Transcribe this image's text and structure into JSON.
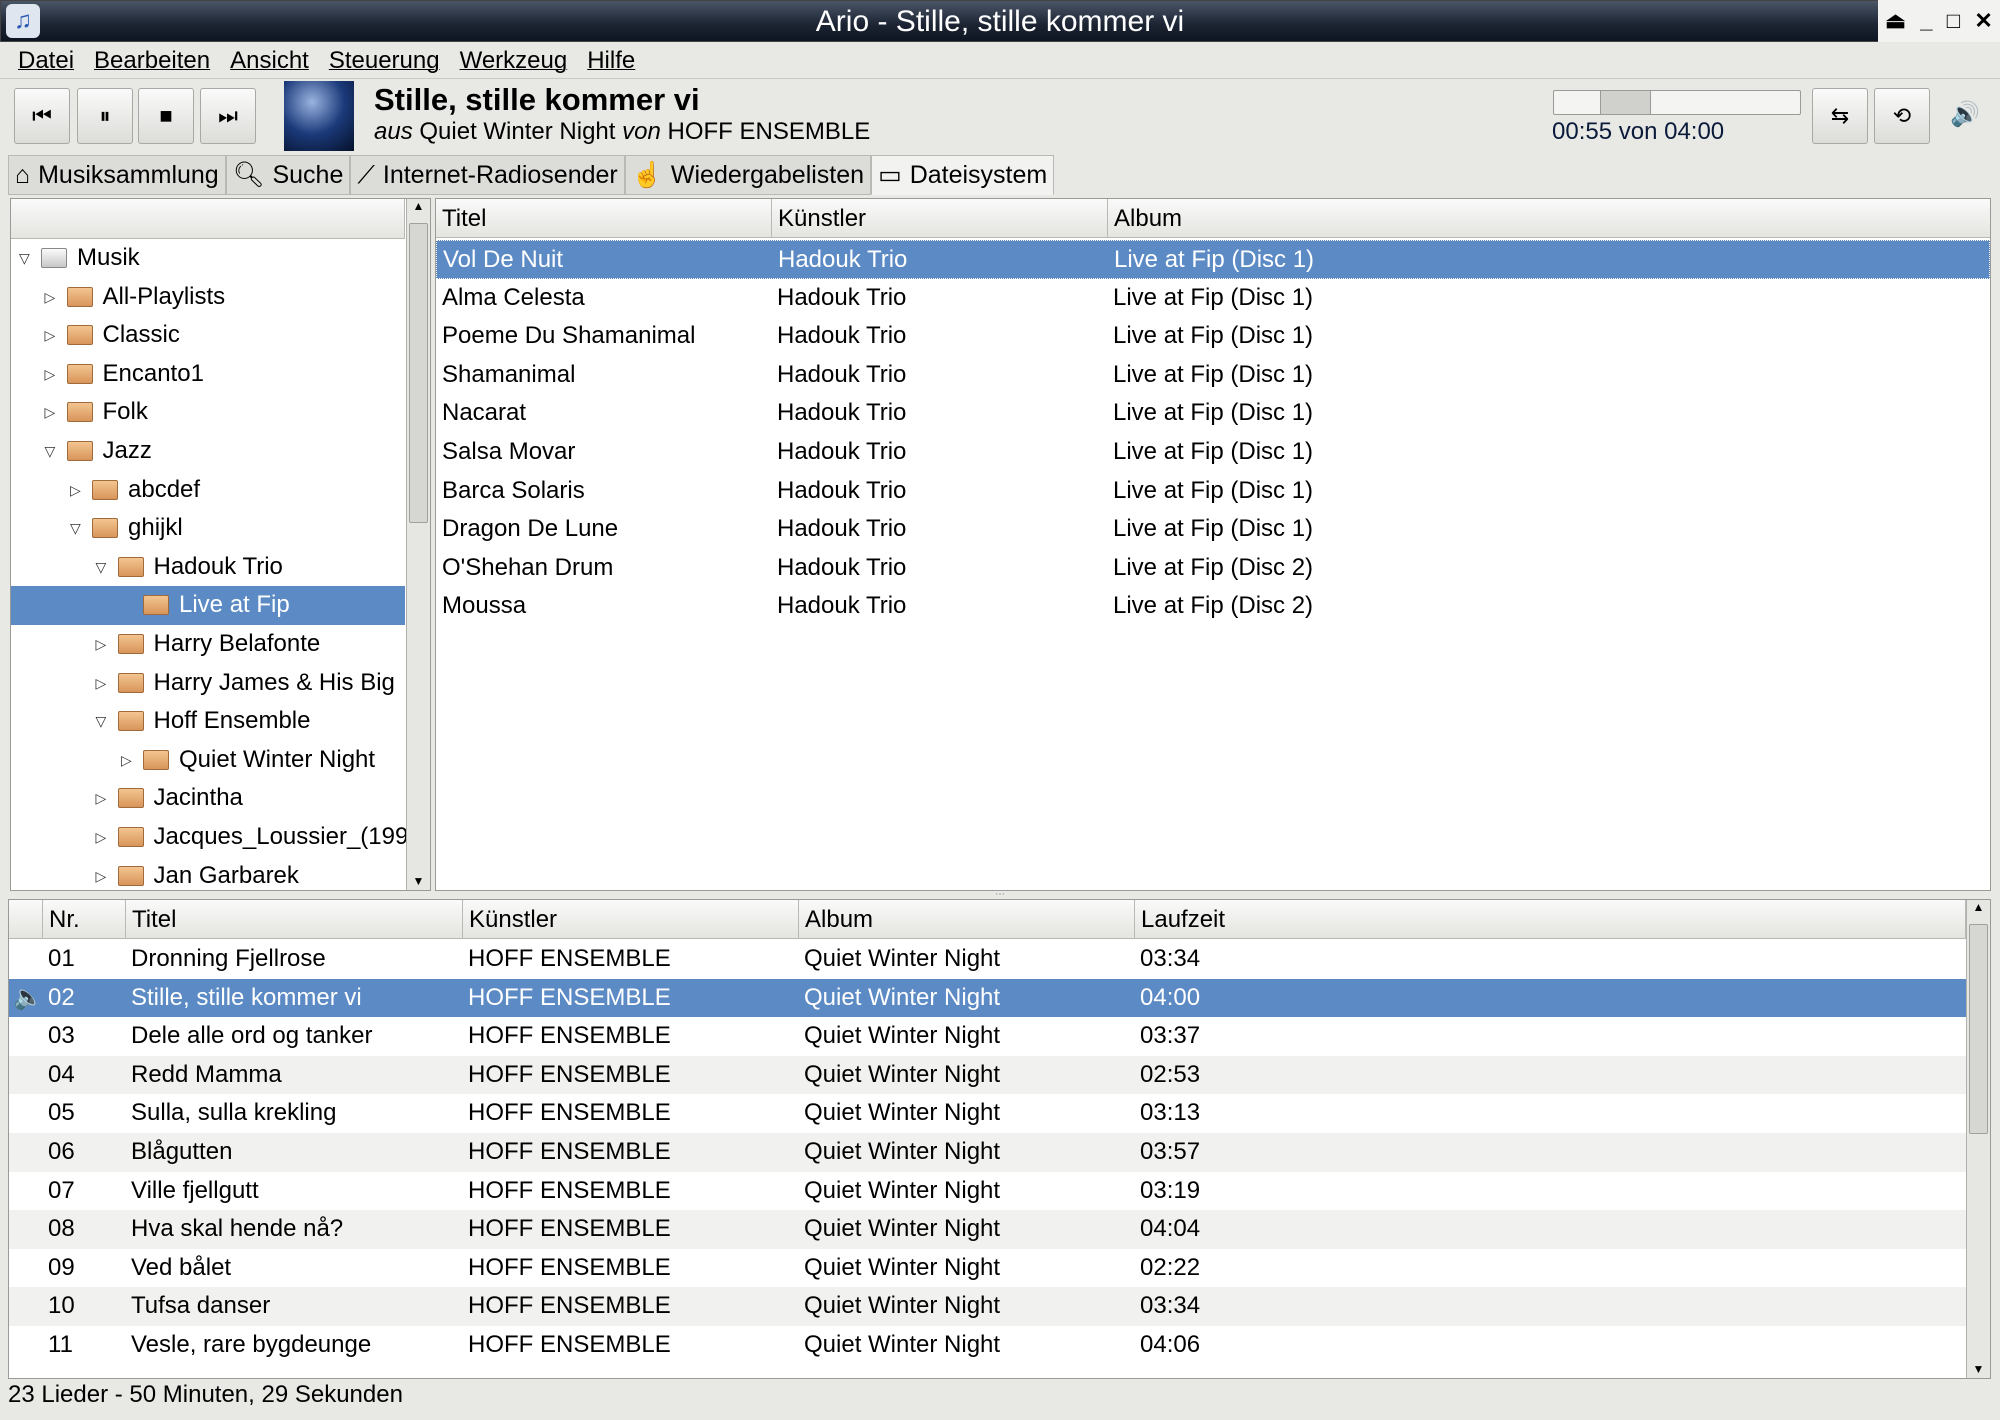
{
  "window": {
    "title": "Ario - Stille, stille kommer vi",
    "buttons": [
      "shade",
      "minimize",
      "maximize",
      "close"
    ]
  },
  "menu": [
    "Datei",
    "Bearbeiten",
    "Ansicht",
    "Steuerung",
    "Werkzeug",
    "Hilfe"
  ],
  "player": {
    "now_title": "Stille, stille kommer vi",
    "aus": "aus",
    "album": "Quiet Winter Night",
    "von": "von",
    "artist": "HOFF ENSEMBLE",
    "time": "00:55 von 04:00",
    "progress_fraction": 0.229
  },
  "tabs": [
    {
      "label": "Musiksammlung",
      "icon": "home-icon"
    },
    {
      "label": "Suche",
      "icon": "search-icon"
    },
    {
      "label": "Internet-Radiosender",
      "icon": "radio-icon"
    },
    {
      "label": "Wiedergabelisten",
      "icon": "playlist-icon"
    },
    {
      "label": "Dateisystem",
      "icon": "drive-icon",
      "active": true
    }
  ],
  "tree": [
    {
      "label": "Musik",
      "depth": 0,
      "exp": "open",
      "root": true
    },
    {
      "label": "All-Playlists",
      "depth": 1,
      "exp": "closed"
    },
    {
      "label": "Classic",
      "depth": 1,
      "exp": "closed"
    },
    {
      "label": "Encanto1",
      "depth": 1,
      "exp": "closed"
    },
    {
      "label": "Folk",
      "depth": 1,
      "exp": "closed"
    },
    {
      "label": "Jazz",
      "depth": 1,
      "exp": "open"
    },
    {
      "label": "abcdef",
      "depth": 2,
      "exp": "closed"
    },
    {
      "label": "ghijkl",
      "depth": 2,
      "exp": "open"
    },
    {
      "label": "Hadouk Trio",
      "depth": 3,
      "exp": "open"
    },
    {
      "label": "Live at Fip",
      "depth": 4,
      "exp": "none",
      "selected": true
    },
    {
      "label": "Harry Belafonte",
      "depth": 3,
      "exp": "closed"
    },
    {
      "label": "Harry James & His Big",
      "depth": 3,
      "exp": "closed"
    },
    {
      "label": "Hoff Ensemble",
      "depth": 3,
      "exp": "open"
    },
    {
      "label": "Quiet Winter Night",
      "depth": 4,
      "exp": "closed"
    },
    {
      "label": "Jacintha",
      "depth": 3,
      "exp": "closed"
    },
    {
      "label": "Jacques_Loussier_(199",
      "depth": 3,
      "exp": "closed"
    },
    {
      "label": "Jan Garbarek",
      "depth": 3,
      "exp": "closed"
    }
  ],
  "songs": {
    "columns": [
      "Titel",
      "Künstler",
      "Album"
    ],
    "rows": [
      [
        "Vol De Nuit",
        "Hadouk Trio",
        "Live at Fip (Disc 1)"
      ],
      [
        "Alma Celesta",
        "Hadouk Trio",
        "Live at Fip (Disc 1)"
      ],
      [
        "Poeme Du Shamanimal",
        "Hadouk Trio",
        "Live at Fip (Disc 1)"
      ],
      [
        "Shamanimal",
        "Hadouk Trio",
        "Live at Fip (Disc 1)"
      ],
      [
        "Nacarat",
        "Hadouk Trio",
        "Live at Fip (Disc 1)"
      ],
      [
        "Salsa Movar",
        "Hadouk Trio",
        "Live at Fip (Disc 1)"
      ],
      [
        "Barca Solaris",
        "Hadouk Trio",
        "Live at Fip (Disc 1)"
      ],
      [
        "Dragon De Lune",
        "Hadouk Trio",
        "Live at Fip (Disc 1)"
      ],
      [
        "O'Shehan Drum",
        "Hadouk Trio",
        "Live at Fip (Disc 2)"
      ],
      [
        "Moussa",
        "Hadouk Trio",
        "Live at Fip (Disc 2)"
      ]
    ],
    "selected": 0
  },
  "playlist": {
    "columns": [
      "",
      "Nr.",
      "Titel",
      "Künstler",
      "Album",
      "Laufzeit"
    ],
    "rows": [
      [
        "01",
        "Dronning Fjellrose",
        "HOFF ENSEMBLE",
        "Quiet Winter Night",
        "03:34"
      ],
      [
        "02",
        "Stille, stille kommer vi",
        "HOFF ENSEMBLE",
        "Quiet Winter Night",
        "04:00"
      ],
      [
        "03",
        "Dele alle ord og tanker",
        "HOFF ENSEMBLE",
        "Quiet Winter Night",
        "03:37"
      ],
      [
        "04",
        "Redd Mamma",
        "HOFF ENSEMBLE",
        "Quiet Winter Night",
        "02:53"
      ],
      [
        "05",
        "Sulla, sulla krekling",
        "HOFF ENSEMBLE",
        "Quiet Winter Night",
        "03:13"
      ],
      [
        "06",
        "Blågutten",
        "HOFF ENSEMBLE",
        "Quiet Winter Night",
        "03:57"
      ],
      [
        "07",
        "Ville fjellgutt",
        "HOFF ENSEMBLE",
        "Quiet Winter Night",
        "03:19"
      ],
      [
        "08",
        "Hva skal hende nå?",
        "HOFF ENSEMBLE",
        "Quiet Winter Night",
        "04:04"
      ],
      [
        "09",
        "Ved bålet",
        "HOFF ENSEMBLE",
        "Quiet Winter Night",
        "02:22"
      ],
      [
        "10",
        "Tufsa danser",
        "HOFF ENSEMBLE",
        "Quiet Winter Night",
        "03:34"
      ],
      [
        "11",
        "Vesle, rare bygdeunge",
        "HOFF ENSEMBLE",
        "Quiet Winter Night",
        "04:06"
      ]
    ],
    "playing": 1
  },
  "status": "23 Lieder - 50 Minuten, 29 Sekunden",
  "colors": {
    "selection": "#5b8ac4",
    "titlebar": "#1c2433"
  }
}
